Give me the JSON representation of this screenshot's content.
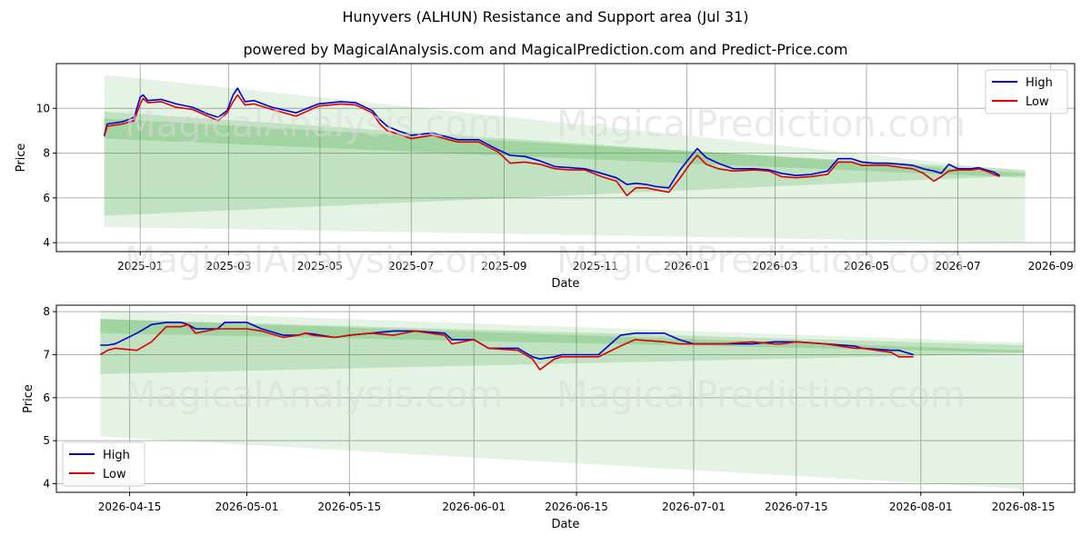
{
  "title": "Hunyvers (ALHUN) Resistance and Support area (Jul 31)",
  "subtitle": "powered by MagicalAnalysis.com and MagicalPrediction.com and Predict-Price.com",
  "watermarks": [
    "MagicalAnalysis.com",
    "MagicalPrediction.com"
  ],
  "colors": {
    "high": "#0000cc",
    "low": "#dd0000",
    "band": "#2ca02c"
  },
  "chart_data": [
    {
      "type": "line",
      "xlabel": "Date",
      "ylabel": "Price",
      "xlim": [
        "2024-11-06",
        "2026-09-17"
      ],
      "ylim": [
        3.6,
        12.0
      ],
      "x_ticks": [
        "2025-01",
        "2025-03",
        "2025-05",
        "2025-07",
        "2025-09",
        "2025-11",
        "2026-01",
        "2026-03",
        "2026-05",
        "2026-07",
        "2026-09"
      ],
      "x_tick_dates": [
        "2025-01-01",
        "2025-03-01",
        "2025-05-01",
        "2025-07-01",
        "2025-09-01",
        "2025-11-01",
        "2026-01-01",
        "2026-03-01",
        "2026-05-01",
        "2026-07-01",
        "2026-09-01"
      ],
      "y_ticks": [
        4,
        6,
        8,
        10
      ],
      "grid": true,
      "legend": "top-right",
      "bands": [
        {
          "x": [
            "2024-12-08",
            "2026-08-15"
          ],
          "upper": [
            11.5,
            7.2
          ],
          "lower": [
            4.7,
            4.0
          ],
          "opacity": 0.12
        },
        {
          "x": [
            "2024-12-08",
            "2026-08-15"
          ],
          "upper": [
            9.85,
            7.1
          ],
          "lower": [
            5.2,
            7.0
          ],
          "opacity": 0.2
        },
        {
          "x": [
            "2024-12-08",
            "2026-08-15"
          ],
          "upper": [
            9.55,
            7.25
          ],
          "lower": [
            8.65,
            6.9
          ],
          "opacity": 0.2
        }
      ],
      "series": [
        {
          "name": "High",
          "x": [
            "2024-12-08",
            "2024-12-10",
            "2024-12-20",
            "2024-12-28",
            "2025-01-01",
            "2025-01-03",
            "2025-01-06",
            "2025-01-15",
            "2025-01-25",
            "2025-02-05",
            "2025-02-15",
            "2025-02-22",
            "2025-02-28",
            "2025-03-04",
            "2025-03-07",
            "2025-03-12",
            "2025-03-18",
            "2025-03-30",
            "2025-04-15",
            "2025-04-30",
            "2025-05-15",
            "2025-05-25",
            "2025-06-05",
            "2025-06-10",
            "2025-06-15",
            "2025-06-22",
            "2025-07-01",
            "2025-07-15",
            "2025-08-01",
            "2025-08-15",
            "2025-08-28",
            "2025-09-05",
            "2025-09-15",
            "2025-09-25",
            "2025-10-05",
            "2025-10-15",
            "2025-10-25",
            "2025-11-05",
            "2025-11-15",
            "2025-11-22",
            "2025-11-28",
            "2025-12-05",
            "2025-12-12",
            "2025-12-20",
            "2025-12-27",
            "2026-01-03",
            "2026-01-08",
            "2026-01-14",
            "2026-01-22",
            "2026-02-01",
            "2026-02-15",
            "2026-02-25",
            "2026-03-05",
            "2026-03-15",
            "2026-03-25",
            "2026-04-05",
            "2026-04-12",
            "2026-04-15",
            "2026-04-21",
            "2026-04-28",
            "2026-05-06",
            "2026-05-15",
            "2026-05-25",
            "2026-06-01",
            "2026-06-08",
            "2026-06-15",
            "2026-06-20",
            "2026-06-25",
            "2026-07-01",
            "2026-07-10",
            "2026-07-15",
            "2026-07-20",
            "2026-07-25",
            "2026-07-29"
          ],
          "values": [
            8.8,
            9.3,
            9.4,
            9.6,
            10.5,
            10.6,
            10.35,
            10.4,
            10.2,
            10.05,
            9.75,
            9.6,
            9.9,
            10.6,
            10.9,
            10.3,
            10.35,
            10.05,
            9.8,
            10.2,
            10.3,
            10.25,
            9.9,
            9.5,
            9.2,
            9.0,
            8.8,
            8.9,
            8.6,
            8.6,
            8.15,
            7.9,
            7.85,
            7.65,
            7.4,
            7.35,
            7.3,
            7.1,
            6.9,
            6.6,
            6.65,
            6.6,
            6.5,
            6.45,
            7.2,
            7.8,
            8.2,
            7.8,
            7.55,
            7.3,
            7.3,
            7.25,
            7.1,
            7.0,
            7.05,
            7.2,
            7.75,
            7.75,
            7.75,
            7.6,
            7.55,
            7.55,
            7.5,
            7.45,
            7.3,
            7.2,
            7.1,
            7.5,
            7.3,
            7.3,
            7.35,
            7.25,
            7.15,
            7.0
          ]
        },
        {
          "name": "Low",
          "x": [
            "2024-12-08",
            "2024-12-10",
            "2024-12-20",
            "2024-12-28",
            "2025-01-01",
            "2025-01-03",
            "2025-01-06",
            "2025-01-15",
            "2025-01-25",
            "2025-02-05",
            "2025-02-15",
            "2025-02-22",
            "2025-02-28",
            "2025-03-04",
            "2025-03-07",
            "2025-03-12",
            "2025-03-18",
            "2025-03-30",
            "2025-04-15",
            "2025-04-30",
            "2025-05-15",
            "2025-05-25",
            "2025-06-05",
            "2025-06-10",
            "2025-06-15",
            "2025-06-22",
            "2025-07-01",
            "2025-07-15",
            "2025-08-01",
            "2025-08-15",
            "2025-08-28",
            "2025-09-05",
            "2025-09-15",
            "2025-09-25",
            "2025-10-05",
            "2025-10-15",
            "2025-10-25",
            "2025-11-05",
            "2025-11-15",
            "2025-11-22",
            "2025-11-28",
            "2025-12-05",
            "2025-12-12",
            "2025-12-20",
            "2025-12-27",
            "2026-01-03",
            "2026-01-08",
            "2026-01-14",
            "2026-01-22",
            "2026-02-01",
            "2026-02-15",
            "2026-02-25",
            "2026-03-05",
            "2026-03-15",
            "2026-03-25",
            "2026-04-05",
            "2026-04-12",
            "2026-04-15",
            "2026-04-21",
            "2026-04-28",
            "2026-05-06",
            "2026-05-15",
            "2026-05-25",
            "2026-06-01",
            "2026-06-08",
            "2026-06-15",
            "2026-06-20",
            "2026-06-25",
            "2026-07-01",
            "2026-07-10",
            "2026-07-15",
            "2026-07-20",
            "2026-07-25",
            "2026-07-29"
          ],
          "values": [
            8.75,
            9.2,
            9.3,
            9.45,
            10.2,
            10.45,
            10.25,
            10.3,
            10.05,
            9.95,
            9.65,
            9.45,
            9.8,
            10.3,
            10.6,
            10.15,
            10.2,
            9.95,
            9.65,
            10.1,
            10.2,
            10.15,
            9.8,
            9.3,
            9.0,
            8.85,
            8.65,
            8.8,
            8.5,
            8.5,
            8.05,
            7.55,
            7.6,
            7.5,
            7.3,
            7.25,
            7.25,
            6.95,
            6.75,
            6.1,
            6.45,
            6.45,
            6.35,
            6.25,
            6.85,
            7.5,
            7.9,
            7.5,
            7.3,
            7.2,
            7.25,
            7.2,
            6.95,
            6.9,
            6.95,
            7.05,
            7.6,
            7.6,
            7.6,
            7.45,
            7.45,
            7.45,
            7.35,
            7.3,
            7.1,
            6.75,
            6.95,
            7.2,
            7.25,
            7.25,
            7.3,
            7.2,
            7.05,
            6.95
          ]
        }
      ]
    },
    {
      "type": "line",
      "xlabel": "Date",
      "ylabel": "Price",
      "xlim": [
        "2026-04-05",
        "2026-08-22"
      ],
      "ylim": [
        3.8,
        8.15
      ],
      "x_ticks": [
        "2026-04-15",
        "2026-05-01",
        "2026-05-15",
        "2026-06-01",
        "2026-06-15",
        "2026-07-01",
        "2026-07-15",
        "2026-08-01",
        "2026-08-15"
      ],
      "y_ticks": [
        4,
        5,
        6,
        7,
        8
      ],
      "grid": true,
      "legend": "bottom-left",
      "bands": [
        {
          "x": [
            "2026-04-11",
            "2026-08-15"
          ],
          "upper": [
            8.03,
            7.28
          ],
          "lower": [
            5.1,
            3.88
          ],
          "opacity": 0.12
        },
        {
          "x": [
            "2026-04-11",
            "2026-08-15"
          ],
          "upper": [
            7.83,
            7.22
          ],
          "lower": [
            6.55,
            7.03
          ],
          "opacity": 0.2
        },
        {
          "x": [
            "2026-04-11",
            "2026-08-15"
          ],
          "upper": [
            7.83,
            7.1
          ],
          "lower": [
            7.5,
            7.05
          ],
          "opacity": 0.2
        }
      ],
      "series": [
        {
          "name": "High",
          "x": [
            "2026-04-11",
            "2026-04-12",
            "2026-04-13",
            "2026-04-16",
            "2026-04-18",
            "2026-04-20",
            "2026-04-22",
            "2026-04-23",
            "2026-04-24",
            "2026-04-27",
            "2026-04-28",
            "2026-05-01",
            "2026-05-03",
            "2026-05-06",
            "2026-05-08",
            "2026-05-09",
            "2026-05-10",
            "2026-05-13",
            "2026-05-15",
            "2026-05-18",
            "2026-05-21",
            "2026-05-24",
            "2026-05-28",
            "2026-05-29",
            "2026-06-01",
            "2026-06-03",
            "2026-06-07",
            "2026-06-09",
            "2026-06-10",
            "2026-06-12",
            "2026-06-13",
            "2026-06-18",
            "2026-06-21",
            "2026-06-23",
            "2026-06-27",
            "2026-06-29",
            "2026-07-01",
            "2026-07-05",
            "2026-07-09",
            "2026-07-12",
            "2026-07-13",
            "2026-07-15",
            "2026-07-19",
            "2026-07-23",
            "2026-07-24",
            "2026-07-28",
            "2026-07-29",
            "2026-07-31"
          ],
          "values": [
            7.22,
            7.22,
            7.25,
            7.5,
            7.7,
            7.75,
            7.75,
            7.7,
            7.6,
            7.6,
            7.75,
            7.75,
            7.6,
            7.45,
            7.45,
            7.5,
            7.48,
            7.4,
            7.45,
            7.5,
            7.55,
            7.55,
            7.5,
            7.35,
            7.35,
            7.15,
            7.15,
            6.95,
            6.9,
            6.95,
            7.0,
            7.0,
            7.45,
            7.5,
            7.5,
            7.35,
            7.25,
            7.25,
            7.25,
            7.3,
            7.3,
            7.3,
            7.25,
            7.2,
            7.15,
            7.1,
            7.1,
            7.0
          ]
        },
        {
          "name": "Low",
          "x": [
            "2026-04-11",
            "2026-04-12",
            "2026-04-13",
            "2026-04-16",
            "2026-04-18",
            "2026-04-20",
            "2026-04-22",
            "2026-04-23",
            "2026-04-24",
            "2026-04-27",
            "2026-04-28",
            "2026-05-01",
            "2026-05-03",
            "2026-05-06",
            "2026-05-08",
            "2026-05-09",
            "2026-05-10",
            "2026-05-13",
            "2026-05-15",
            "2026-05-18",
            "2026-05-21",
            "2026-05-24",
            "2026-05-28",
            "2026-05-29",
            "2026-06-01",
            "2026-06-03",
            "2026-06-07",
            "2026-06-09",
            "2026-06-10",
            "2026-06-12",
            "2026-06-13",
            "2026-06-18",
            "2026-06-21",
            "2026-06-23",
            "2026-06-27",
            "2026-06-29",
            "2026-07-01",
            "2026-07-05",
            "2026-07-09",
            "2026-07-12",
            "2026-07-13",
            "2026-07-15",
            "2026-07-19",
            "2026-07-23",
            "2026-07-24",
            "2026-07-28",
            "2026-07-29",
            "2026-07-31"
          ],
          "values": [
            7.0,
            7.1,
            7.15,
            7.1,
            7.3,
            7.65,
            7.65,
            7.7,
            7.5,
            7.6,
            7.6,
            7.6,
            7.55,
            7.4,
            7.45,
            7.5,
            7.45,
            7.4,
            7.45,
            7.5,
            7.45,
            7.55,
            7.45,
            7.25,
            7.35,
            7.15,
            7.1,
            6.9,
            6.65,
            6.9,
            6.95,
            6.95,
            7.2,
            7.35,
            7.3,
            7.25,
            7.25,
            7.25,
            7.3,
            7.25,
            7.25,
            7.3,
            7.25,
            7.15,
            7.15,
            7.05,
            6.95,
            6.95
          ]
        }
      ]
    }
  ]
}
